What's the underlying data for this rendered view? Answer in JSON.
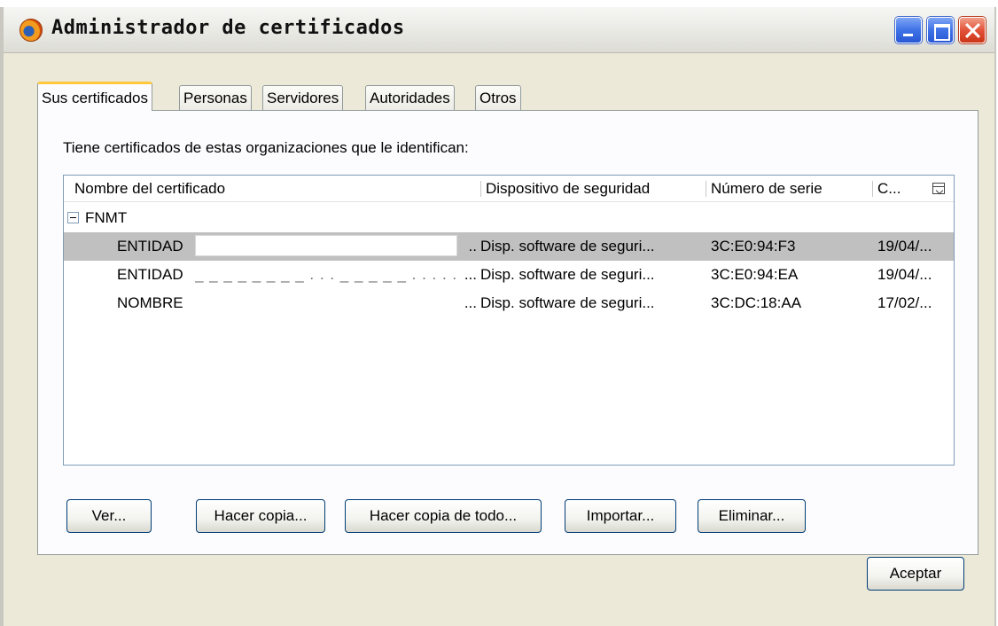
{
  "window": {
    "title": "Administrador de certificados",
    "controls": [
      "minimize",
      "maximize",
      "close"
    ]
  },
  "tabs": [
    {
      "label": "Sus certificados",
      "active": true
    },
    {
      "label": "Personas",
      "active": false
    },
    {
      "label": "Servidores",
      "active": false
    },
    {
      "label": "Autoridades",
      "active": false
    },
    {
      "label": "Otros",
      "active": false
    }
  ],
  "intro_text": "Tiene certificados de estas organizaciones que le identifican:",
  "table": {
    "columns": [
      "Nombre del certificado",
      "Dispositivo de seguridad",
      "Número de serie",
      "C..."
    ],
    "group": {
      "label": "FNMT",
      "expanded": true
    },
    "rows": [
      {
        "name": "ENTIDAD",
        "ellipsis": "..",
        "device": "Disp. software de seguri...",
        "serial": "3C:E0:94:F3",
        "date": "19/04/...",
        "selected": true
      },
      {
        "name": "ENTIDAD",
        "ellipsis": "...",
        "device": "Disp. software de seguri...",
        "serial": "3C:E0:94:EA",
        "date": "19/04/...",
        "selected": false
      },
      {
        "name": "NOMBRE",
        "ellipsis": "...",
        "device": "Disp. software de seguri...",
        "serial": "3C:DC:18:AA",
        "date": "17/02/...",
        "selected": false
      }
    ]
  },
  "buttons": {
    "ver": "Ver...",
    "hacer_copia": "Hacer copia...",
    "hacer_copia_todo": "Hacer copia de todo...",
    "importar": "Importar...",
    "eliminar": "Eliminar...",
    "aceptar": "Aceptar"
  },
  "colors": {
    "window_bg": "#ece9d8",
    "selected_row": "#c0c0c0",
    "active_tab_accent": "#ffc83c",
    "button_border": "#003c74"
  },
  "icons": {
    "app": "firefox-icon",
    "expander": "collapse-minus-icon",
    "column_picker": "column-picker-icon"
  }
}
